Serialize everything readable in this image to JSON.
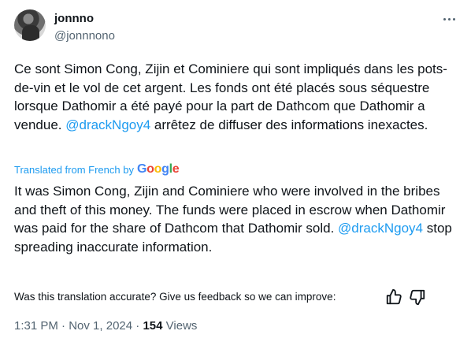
{
  "author": {
    "display_name": "jonnno",
    "handle": "@jonnnono"
  },
  "tweet": {
    "original_parts": [
      "Ce sont Simon Cong, Zijin et Cominiere qui sont impliqués dans les pots-de-vin et le vol de cet argent. Les fonds ont été placés sous séquestre lorsque Dathomir a été payé pour la part de Dathcom que Dathomir a vendue. ",
      "@drackNgoy4",
      " arrêtez de diffuser des informations inexactes."
    ],
    "translated_by_label": "Translated from French by",
    "translator_logo_text": "Google",
    "translated_parts": [
      "It was Simon Cong, Zijin and Cominiere who were involved in the bribes and theft of this money. The funds were placed in escrow when Dathomir was paid for the share of Dathcom that Dathomir sold. ",
      "@drackNgoy4",
      " stop spreading inaccurate information."
    ]
  },
  "feedback": {
    "prompt": "Was this translation accurate? Give us feedback so we can improve:",
    "thumbs_up_icon": "thumbs-up-icon",
    "thumbs_down_icon": "thumbs-down-icon"
  },
  "meta": {
    "time": "1:31 PM",
    "separator": "·",
    "date": "Nov 1, 2024",
    "views_count": "154",
    "views_label": "Views"
  },
  "colors": {
    "accent": "#1d9bf0",
    "text": "#0f1419",
    "secondary": "#536471"
  }
}
